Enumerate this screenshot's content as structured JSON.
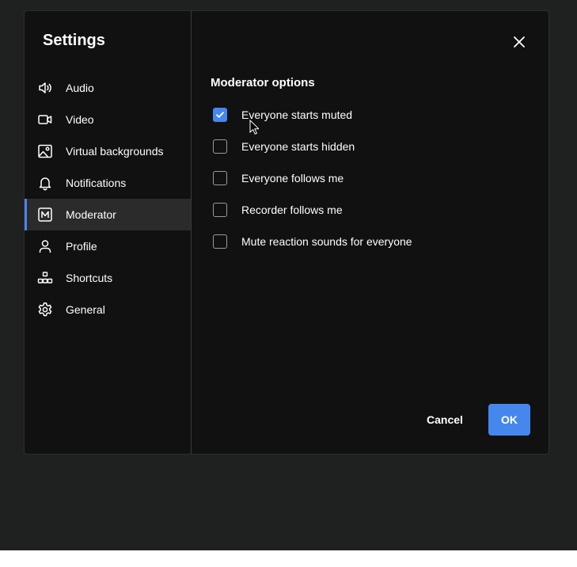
{
  "dialog": {
    "title": "Settings"
  },
  "sidebar": {
    "items": [
      {
        "label": "Audio",
        "icon": "speaker-icon"
      },
      {
        "label": "Video",
        "icon": "video-camera-icon"
      },
      {
        "label": "Virtual backgrounds",
        "icon": "image-icon"
      },
      {
        "label": "Notifications",
        "icon": "bell-icon"
      },
      {
        "label": "Moderator",
        "icon": "moderator-icon",
        "active": true
      },
      {
        "label": "Profile",
        "icon": "person-icon"
      },
      {
        "label": "Shortcuts",
        "icon": "shortcuts-icon"
      },
      {
        "label": "General",
        "icon": "gear-icon"
      }
    ]
  },
  "moderator": {
    "section_title": "Moderator options",
    "options": [
      {
        "label": "Everyone starts muted",
        "checked": true
      },
      {
        "label": "Everyone starts hidden",
        "checked": false
      },
      {
        "label": "Everyone follows me",
        "checked": false
      },
      {
        "label": "Recorder follows me",
        "checked": false
      },
      {
        "label": "Mute reaction sounds for everyone",
        "checked": false
      }
    ]
  },
  "footer": {
    "cancel_label": "Cancel",
    "ok_label": "OK"
  },
  "colors": {
    "accent": "#4687ed",
    "dialog_bg": "#111111",
    "backdrop": "#1f2020",
    "active_item_bg": "#2b2b2b"
  }
}
